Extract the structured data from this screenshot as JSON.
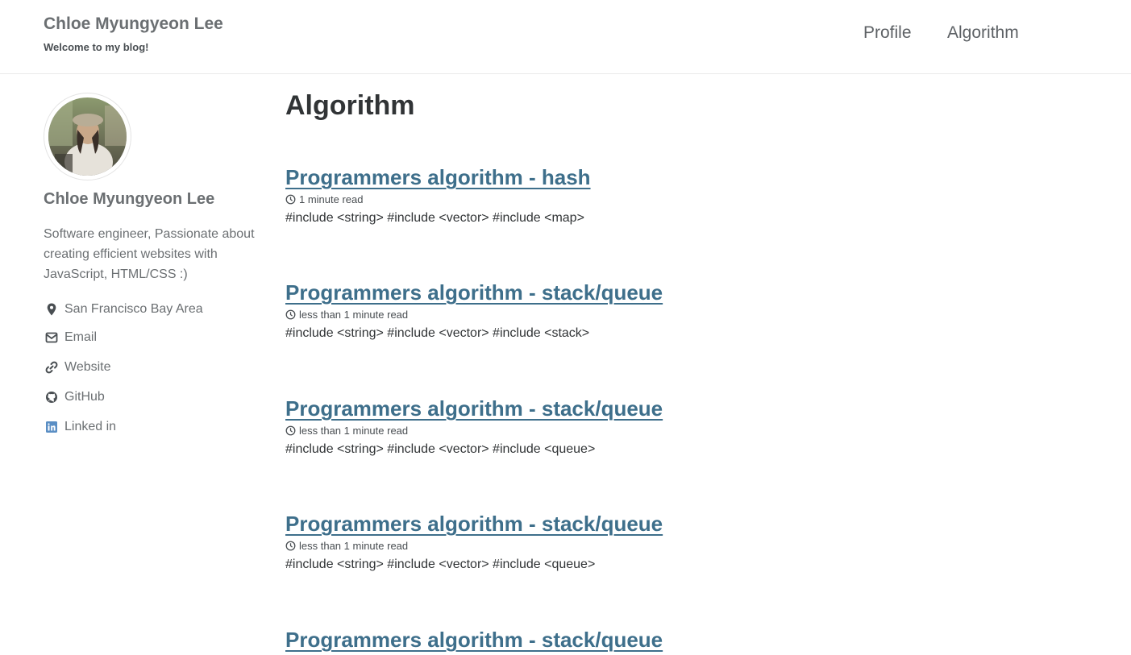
{
  "header": {
    "site_title": "Chloe Myungyeon Lee",
    "site_subtitle": "Welcome to my blog!",
    "nav": [
      "Profile",
      "Algorithm"
    ]
  },
  "sidebar": {
    "author_name": "Chloe Myungyeon Lee",
    "bio": "Software engineer, Passionate about creating efficient websites with JavaScript, HTML/CSS :)",
    "links": [
      {
        "label": "San Francisco Bay Area",
        "icon": "map-marker-icon"
      },
      {
        "label": "Email",
        "icon": "envelope-icon"
      },
      {
        "label": "Website",
        "icon": "link-icon"
      },
      {
        "label": "GitHub",
        "icon": "github-icon"
      },
      {
        "label": "Linked in",
        "icon": "linkedin-icon"
      }
    ]
  },
  "main": {
    "page_title": "Algorithm",
    "posts": [
      {
        "title": "Programmers algorithm - hash",
        "read_time": "1 minute read",
        "excerpt": "#include <string> #include <vector> #include <map>"
      },
      {
        "title": "Programmers algorithm - stack/queue",
        "read_time": "less than 1 minute read",
        "excerpt": "#include <string> #include <vector> #include <stack>"
      },
      {
        "title": "Programmers algorithm - stack/queue",
        "read_time": "less than 1 minute read",
        "excerpt": "#include <string> #include <vector> #include <queue>"
      },
      {
        "title": "Programmers algorithm - stack/queue",
        "read_time": "less than 1 minute read",
        "excerpt": "#include <string> #include <vector> #include <queue>"
      },
      {
        "title": "Programmers algorithm - stack/queue",
        "read_time": "",
        "excerpt": ""
      }
    ]
  },
  "colors": {
    "link": "#3e6f8b",
    "text": "#494e52",
    "linkedin": "#5a8ec4"
  }
}
